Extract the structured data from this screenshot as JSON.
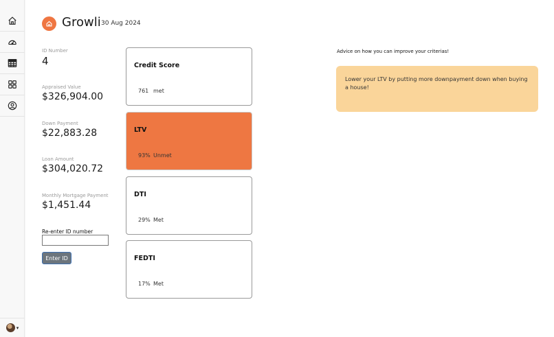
{
  "app": {
    "name": "Growli",
    "date": "30 Aug 2024"
  },
  "sidebar": {
    "items": [
      {
        "icon": "home-icon"
      },
      {
        "icon": "speedometer-icon"
      },
      {
        "icon": "table-icon"
      },
      {
        "icon": "grid-icon"
      },
      {
        "icon": "user-circle-icon"
      }
    ],
    "caret": "▾"
  },
  "fields": {
    "id_number": {
      "label": "ID Number",
      "value": "4"
    },
    "appraised_value": {
      "label": "Appraised Value",
      "value": "$326,904.00"
    },
    "down_payment": {
      "label": "Down Payment",
      "value": "$22,883.28"
    },
    "loan_amount": {
      "label": "Loan Amount",
      "value": "$304,020.72"
    },
    "monthly_payment": {
      "label": "Monthly Mortgage Payment",
      "value": "$1,451.44"
    }
  },
  "reenter": {
    "label": "Re-enter ID number",
    "input_value": "",
    "button_label": "Enter ID"
  },
  "cards": {
    "credit_score": {
      "title": "Credit Score",
      "value": "761",
      "status": "met"
    },
    "ltv": {
      "title": "LTV",
      "value": "93%",
      "status": "Unmet"
    },
    "dti": {
      "title": "DTI",
      "value": "29%",
      "status": "Met"
    },
    "fedti": {
      "title": "FEDTI",
      "value": "17%",
      "status": "Met"
    }
  },
  "advice": {
    "title": "Advice on how you can improve your criterias!",
    "text": "Lower your LTV by putting more downpayment down when buying a house!"
  },
  "colors": {
    "accent": "#ef7642",
    "unmet_card": "#ee7742",
    "advice_bg": "#fad59a",
    "button_bg": "#6c757d"
  }
}
